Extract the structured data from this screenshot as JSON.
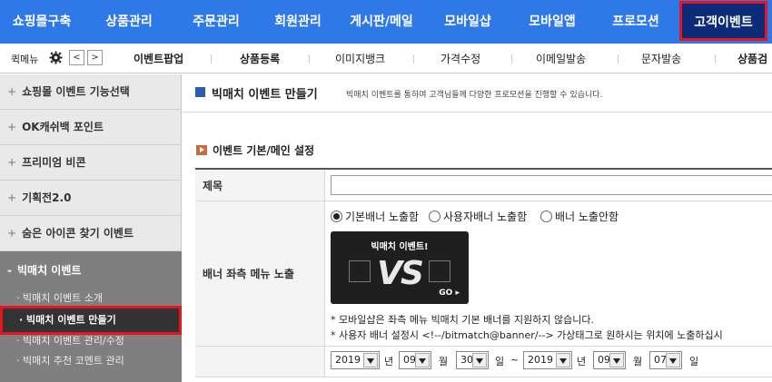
{
  "topnav": {
    "items": [
      "쇼핑몰구축",
      "상품관리",
      "주문관리",
      "회원관리",
      "게시판/메일",
      "모바일샵",
      "모바일앱",
      "프로모션",
      "고객이벤트"
    ]
  },
  "quickbar": {
    "label": "퀵메뉴",
    "prev": "<",
    "next": ">",
    "items": [
      "이벤트팝업",
      "상품등록",
      "이미지뱅크",
      "가격수정",
      "이메일발송",
      "문자발송",
      "상품검"
    ]
  },
  "sidebar": {
    "items": [
      "쇼핑몰 이벤트 기능선택",
      "OK캐쉬백 포인트",
      "프리미엄 비콘",
      "기획전2.0",
      "숨은 아이콘 찾기 이벤트"
    ],
    "group": {
      "head": "빅매치 이벤트",
      "subs": [
        "빅매치 이벤트 소개",
        "빅매치 이벤트 만들기",
        "빅매치 이벤트 관리/수정",
        "빅매치 추천 코멘트 관리"
      ]
    }
  },
  "content": {
    "title": "빅매치 이벤트 만들기",
    "desc": "빅매치 이벤트를 통하여 고객님들께 다양한 프로모션을 진행할 수 있습니다.",
    "section": "이벤트 기본/메인 설정",
    "row_title_label": "제목",
    "row_banner_label": "배너 좌측 메뉴 노출",
    "radios": [
      "기본배너 노출함",
      "사용자배너 노출함",
      "배너 노출안함"
    ],
    "banner_title": "빅매치 이벤트!",
    "banner_vs": "VS",
    "banner_go": "GO",
    "notes": [
      "* 모바일샵은 좌측 메뉴 빅매치 기본 배너를 지원하지 않습니다.",
      "* 사용자 배너 설정시 <!--/bitmatch@banner/--> 가상태그로 원하시는 위치에 노출하십시"
    ],
    "period": {
      "start_year": "2019",
      "start_month": "09",
      "start_day": "30",
      "end_year": "2019",
      "end_month": "09",
      "end_day": "07",
      "year_unit": "년",
      "month_unit": "월",
      "day_unit": "일",
      "tilde": "~"
    }
  },
  "colors": {
    "nav_bg": "#2f78e8",
    "nav_active": "#0c2c7a",
    "highlight": "#e8141e"
  }
}
